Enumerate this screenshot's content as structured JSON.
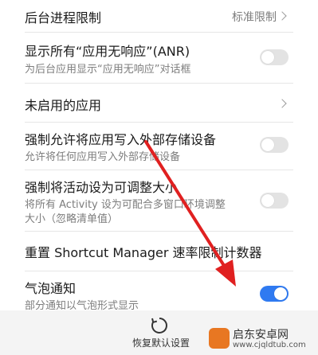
{
  "settings": {
    "background_limit": {
      "label": "后台进程限制",
      "value": "标准限制"
    },
    "anr": {
      "label": "显示所有“应用无响应”(ANR)",
      "desc": "为后台应用显示“应用无响应”对话框",
      "enabled": false
    },
    "disabled_apps": {
      "label": "未启用的应用"
    },
    "force_external": {
      "label": "强制允许将应用写入外部存储设备",
      "desc": "允许将任何应用写入外部存储设备",
      "enabled": false
    },
    "force_resizable": {
      "label": "强制将活动设为可调整大小",
      "desc_line1": "将所有 Activity 设为可配合多窗口环境调整",
      "desc_line2": "大小（忽略清单值）",
      "enabled": false
    },
    "reset_shortcut": {
      "label": "重置 Shortcut Manager 速率限制计数器"
    },
    "bubbles": {
      "label": "气泡通知",
      "desc": "部分通知以气泡形式显示",
      "enabled": true
    }
  },
  "bottom": {
    "restore_label": "恢复默认设置"
  },
  "watermark": {
    "name": "启东安卓网",
    "url": "www.cjqldtub.com"
  },
  "colors": {
    "accent": "#2f7af1",
    "annotation": "#e02020"
  }
}
